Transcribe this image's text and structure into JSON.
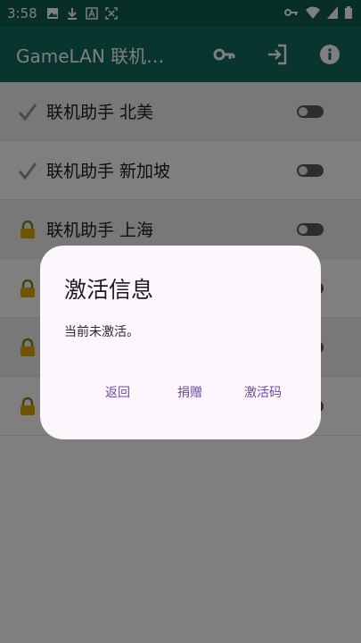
{
  "status_bar": {
    "time": "3:58",
    "left_icons": [
      "image-icon",
      "download-icon",
      "font-icon",
      "screenshot-icon"
    ],
    "right_icons": [
      "vpn-key-icon",
      "wifi-icon",
      "signal-icon",
      "battery-icon"
    ]
  },
  "app_bar": {
    "title": "GameLAN 联机…",
    "actions": [
      "key-icon",
      "login-icon",
      "info-icon"
    ],
    "color": "#116b5a"
  },
  "list": {
    "items": [
      {
        "label": "联机助手 北美",
        "status_icon": "check-icon",
        "enabled": false
      },
      {
        "label": "联机助手 新加坡",
        "status_icon": "check-icon",
        "enabled": false
      },
      {
        "label": "联机助手 上海",
        "status_icon": "lock-icon",
        "enabled": false
      },
      {
        "label": "",
        "status_icon": "lock-icon",
        "enabled": false
      },
      {
        "label": "",
        "status_icon": "lock-icon",
        "enabled": false
      },
      {
        "label": "",
        "status_icon": "lock-icon",
        "enabled": false
      }
    ]
  },
  "dialog": {
    "title": "激活信息",
    "message": "当前未激活。",
    "buttons": {
      "back": "返回",
      "donate": "捐赠",
      "activation_code": "激活码"
    },
    "accent": "#6a4aa6"
  }
}
